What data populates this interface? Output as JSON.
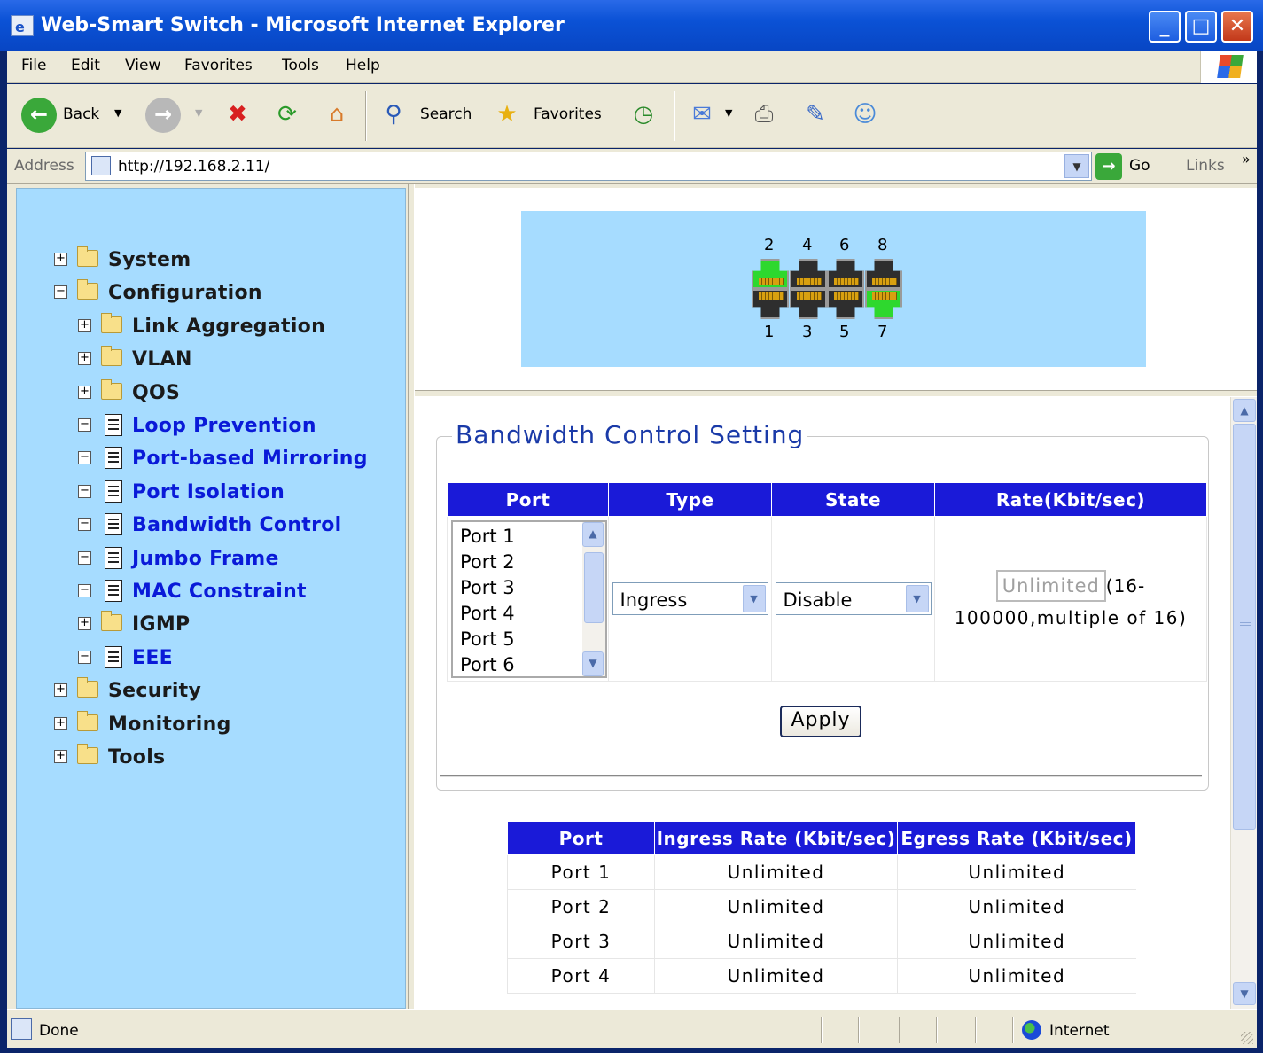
{
  "window": {
    "title": "Web-Smart Switch - Microsoft Internet Explorer",
    "minimize": "_",
    "maximize": "□",
    "close": "✕"
  },
  "menu": [
    "File",
    "Edit",
    "View",
    "Favorites",
    "Tools",
    "Help"
  ],
  "toolbar": {
    "back_label": "Back",
    "search_label": "Search",
    "favorites_label": "Favorites"
  },
  "address": {
    "label": "Address",
    "url": "http://192.168.2.11/",
    "go_label": "Go",
    "links_label": "Links"
  },
  "tree": {
    "items": [
      {
        "label": "System",
        "expander": "+",
        "icon": "folder-icon",
        "level": 0,
        "style": "dark"
      },
      {
        "label": "Configuration",
        "expander": "−",
        "icon": "folder-open-icon",
        "level": 0,
        "style": "dark"
      },
      {
        "label": "Link Aggregation",
        "expander": "+",
        "icon": "folder-icon",
        "level": 1,
        "style": "dark"
      },
      {
        "label": "VLAN",
        "expander": "+",
        "icon": "folder-icon",
        "level": 1,
        "style": "dark"
      },
      {
        "label": "QOS",
        "expander": "+",
        "icon": "folder-icon",
        "level": 1,
        "style": "dark"
      },
      {
        "label": "Loop Prevention",
        "expander": "−",
        "icon": "document-icon",
        "level": 1,
        "style": "link"
      },
      {
        "label": "Port-based Mirroring",
        "expander": "−",
        "icon": "document-icon",
        "level": 1,
        "style": "link"
      },
      {
        "label": "Port Isolation",
        "expander": "−",
        "icon": "document-icon",
        "level": 1,
        "style": "link"
      },
      {
        "label": "Bandwidth Control",
        "expander": "−",
        "icon": "document-icon",
        "level": 1,
        "style": "link"
      },
      {
        "label": "Jumbo Frame",
        "expander": "−",
        "icon": "document-icon",
        "level": 1,
        "style": "link"
      },
      {
        "label": "MAC Constraint",
        "expander": "−",
        "icon": "document-icon",
        "level": 1,
        "style": "link"
      },
      {
        "label": "IGMP",
        "expander": "+",
        "icon": "folder-icon",
        "level": 1,
        "style": "dark"
      },
      {
        "label": "EEE",
        "expander": "−",
        "icon": "document-icon",
        "level": 1,
        "style": "link"
      },
      {
        "label": "Security",
        "expander": "+",
        "icon": "folder-icon",
        "level": 0,
        "style": "dark"
      },
      {
        "label": "Monitoring",
        "expander": "+",
        "icon": "folder-icon",
        "level": 0,
        "style": "dark"
      },
      {
        "label": "Tools",
        "expander": "+",
        "icon": "folder-icon",
        "level": 0,
        "style": "dark"
      }
    ]
  },
  "ports_panel": {
    "top_numbers": [
      "2",
      "4",
      "6",
      "8"
    ],
    "bottom_numbers": [
      "1",
      "3",
      "5",
      "7"
    ],
    "link_up_ports": [
      "2",
      "7"
    ],
    "active_color": "#2ed82e"
  },
  "bandwidth": {
    "legend": "Bandwidth Control Setting",
    "headers": [
      "Port",
      "Type",
      "State",
      "Rate(Kbit/sec)"
    ],
    "port_options": [
      "Port 1",
      "Port 2",
      "Port 3",
      "Port 4",
      "Port 5",
      "Port 6"
    ],
    "type_value": "Ingress",
    "state_value": "Disable",
    "rate_value": "Unlimited",
    "rate_hint_1": "(16-",
    "rate_hint_2": "100000,multiple of 16)",
    "apply_label": "Apply"
  },
  "summary": {
    "headers": [
      "Port",
      "Ingress Rate (Kbit/sec)",
      "Egress Rate (Kbit/sec)"
    ],
    "rows": [
      [
        "Port 1",
        "Unlimited",
        "Unlimited"
      ],
      [
        "Port 2",
        "Unlimited",
        "Unlimited"
      ],
      [
        "Port 3",
        "Unlimited",
        "Unlimited"
      ],
      [
        "Port 4",
        "Unlimited",
        "Unlimited"
      ]
    ]
  },
  "status": {
    "text": "Done",
    "zone": "Internet"
  },
  "colors": {
    "header_blue": "#1a1ad8",
    "tree_bg": "#a6dcff",
    "link_blue": "#0a1ad8"
  }
}
